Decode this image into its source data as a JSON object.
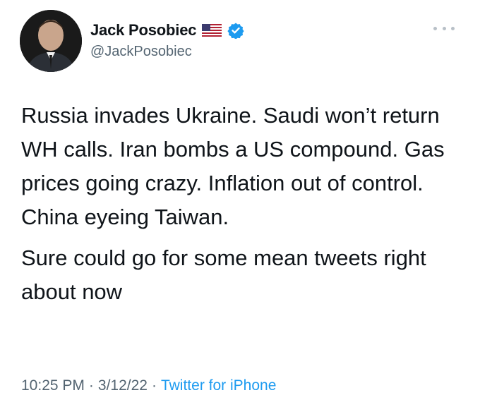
{
  "author": {
    "display_name": "Jack Posobiec",
    "handle": "@JackPosobiec",
    "flag_icon": "us-flag-icon",
    "verified_icon": "verified-badge-icon",
    "verified_color": "#1d9bf0"
  },
  "tweet": {
    "paragraphs": [
      "Russia invades Ukraine. Saudi won’t return WH calls. Iran bombs a US compound. Gas prices going crazy. Inflation out of control. China eyeing Taiwan.",
      "Sure could go for some mean tweets right about now"
    ]
  },
  "meta": {
    "time": "10:25 PM",
    "separator": "·",
    "date": "3/12/22",
    "source": "Twitter for iPhone",
    "source_color": "#1d9bf0"
  },
  "more_icon": "more-dots-icon"
}
